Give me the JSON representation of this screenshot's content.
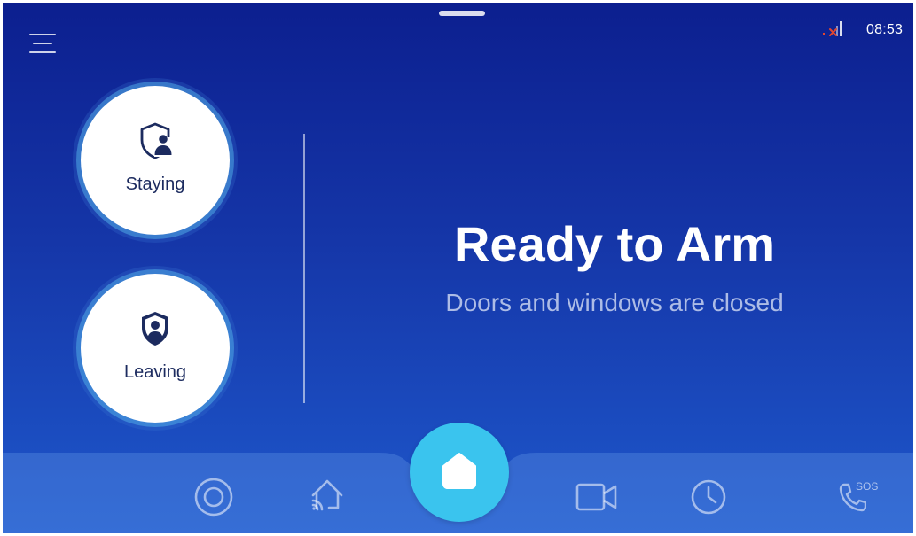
{
  "status_bar": {
    "time": "08:53",
    "signal_icon": "signal-off-icon"
  },
  "header": {
    "menu_icon": "hamburger-menu-icon"
  },
  "modes": [
    {
      "label": "Staying",
      "icon": "shield-person-icon"
    },
    {
      "label": "Leaving",
      "icon": "shield-person-filled-icon"
    }
  ],
  "main": {
    "title": "Ready to Arm",
    "subtitle": "Doors and windows are closed"
  },
  "bottom_nav": {
    "items": [
      {
        "icon": "target-icon"
      },
      {
        "icon": "smart-home-icon"
      },
      {
        "icon": "home-icon",
        "active": true
      },
      {
        "icon": "camera-icon"
      },
      {
        "icon": "clock-icon"
      },
      {
        "icon": "sos-phone-icon",
        "label": "SOS"
      }
    ]
  },
  "colors": {
    "background_top": "#0c1f8f",
    "background_bottom": "#1e58cc",
    "accent": "#3ac4ee",
    "signal_warning": "#e2462f",
    "mode_label": "#1c2b5f"
  }
}
